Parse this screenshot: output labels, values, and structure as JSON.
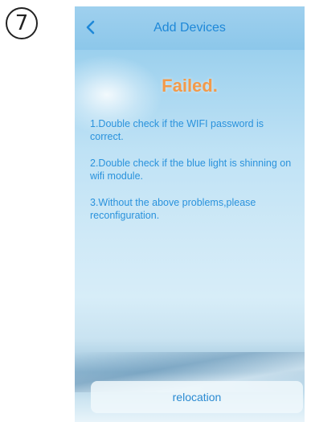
{
  "step": {
    "number": "7"
  },
  "header": {
    "title": "Add Devices",
    "back_icon": "chevron-left-icon"
  },
  "main": {
    "status_title": "Failed.",
    "tips": [
      "1.Double check if the WIFI password is correct.",
      "2.Double check if the blue light is shinning on wifi module.",
      "3.Without the above problems,please reconfiguration."
    ]
  },
  "footer": {
    "relocation_label": "relocation"
  },
  "colors": {
    "accent": "#2a92dc",
    "failed": "#f39a4a",
    "navbar": "#8cc7ea"
  }
}
